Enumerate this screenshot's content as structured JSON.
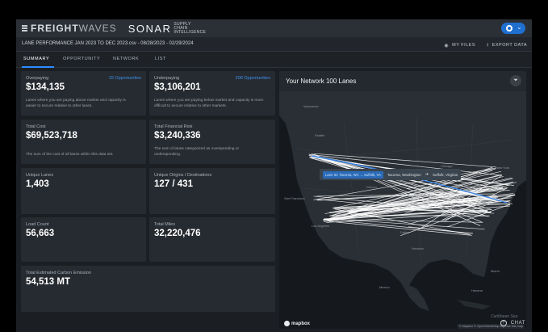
{
  "brand": {
    "name_bold": "FREIGHT",
    "name_thin": "WAVES",
    "product": "SONAR",
    "product_sub": "SUPPLY CHAIN INTELLIGENCE"
  },
  "header": {
    "report_title": "LANE PERFORMANCE JAN 2023 TO DEC 2023.csv - 08/28/2023 - 02/29/2024",
    "actions": [
      {
        "label": "MY FILES",
        "icon": "eye-icon"
      },
      {
        "label": "EXPORT DATA",
        "icon": "download-icon"
      }
    ]
  },
  "tabs": [
    "SUMMARY",
    "OPPORTUNITY",
    "NETWORK",
    "LIST"
  ],
  "active_tab": "SUMMARY",
  "cards": {
    "overpaying": {
      "label": "Overpaying",
      "link": "15 Opportunities",
      "value": "$134,135",
      "desc": "Lanes where you are paying above market and capacity is easier to secure relative to other lanes."
    },
    "underpaying": {
      "label": "Underpaying",
      "link": "208 Opportunities",
      "value": "$3,106,201",
      "desc": "Lanes where you are paying below market and capacity is more difficult to secure relative to other markets."
    },
    "total_cost": {
      "label": "Total Cost",
      "value": "$69,523,718",
      "desc": "The sum of the cost of all lanes within this data set."
    },
    "total_risk": {
      "label": "Total Financial Risk",
      "value": "$3,240,336",
      "desc": "The sum of lanes categorized as overspending or underspending."
    },
    "unique_lanes": {
      "label": "Unique Lanes",
      "value": "1,403"
    },
    "unique_od": {
      "label": "Unique Origins / Destinations",
      "value": "127 / 431"
    },
    "load_count": {
      "label": "Load Count",
      "value": "56,663"
    },
    "total_miles": {
      "label": "Total Miles",
      "value": "32,220,476"
    },
    "carbon": {
      "label": "Total Estimated Carbon Emission",
      "value": "54,513 MT"
    }
  },
  "map": {
    "title": "Your Network 100 Lanes",
    "tooltip": {
      "chip": "Lane ID: Tacoma, WA → Suffolk, VA",
      "origin": "Tacoma, Washington",
      "destination": "Suffolk, Virginia"
    },
    "city_labels": [
      "Vancouver",
      "Seattle",
      "San Francisco",
      "Los Angeles",
      "Chicago",
      "New York",
      "Denver",
      "Dallas",
      "Houston",
      "Miami",
      "Mexico",
      "Havana",
      "Caribbean Sea"
    ],
    "attribution": "© Mapbox © OpenStreetMap Improve this map",
    "logo": "mapbox",
    "colors": {
      "lane": "#ffffff",
      "highlight": "#3a86e8",
      "land": "#2a2f35",
      "water": "#14171b"
    }
  },
  "chat": {
    "label": "CHAT"
  }
}
